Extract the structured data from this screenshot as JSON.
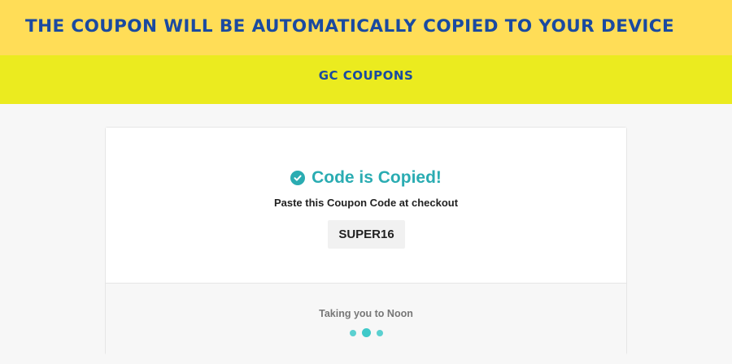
{
  "banner": {
    "text": "THE COUPON WILL BE AUTOMATICALLY COPIED TO YOUR DEVICE"
  },
  "brand": {
    "name": "GC COUPONS"
  },
  "card": {
    "heading": "Code is Copied!",
    "instruction": "Paste this Coupon Code at checkout",
    "coupon_code": "SUPER16",
    "redirect_text": "Taking you to Noon",
    "check_icon": "check-circle-icon"
  },
  "colors": {
    "banner_bg": "#ffdd57",
    "brand_bg": "#ebeb1f",
    "brand_text": "#1a4aa0",
    "accent": "#2aacb2",
    "loader": "#3fc9c9"
  }
}
